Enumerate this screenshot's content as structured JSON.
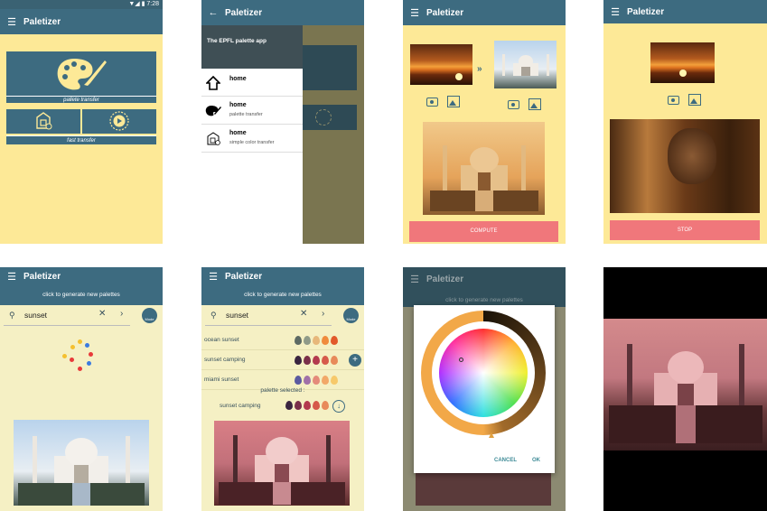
{
  "app": {
    "title": "Paletizer"
  },
  "status": {
    "time": "7:28",
    "icons": "▼◢ ▮"
  },
  "screen1": {
    "palette_transfer_label": "pallete transfer",
    "fast_transfer_label": "fast transfer"
  },
  "screen2": {
    "drawer_header": "The EPFL palette app",
    "items": [
      {
        "title": "home",
        "subtitle": ""
      },
      {
        "title": "home",
        "subtitle": "palette transfer"
      },
      {
        "title": "home",
        "subtitle": "simple color transfer"
      }
    ]
  },
  "screen3": {
    "compute_label": "COMPUTE"
  },
  "screen4": {
    "stop_label": "STOP"
  },
  "screen5": {
    "banner": "click to generate new palettes",
    "search_value": "sunset",
    "badge": "Mode"
  },
  "screen6": {
    "banner": "click to generate new palettes",
    "search_value": "sunset",
    "badge": "Mode",
    "palettes": [
      {
        "name": "ocean sunset",
        "colors": [
          "#5d6a64",
          "#8f9a88",
          "#e7b77a",
          "#f08b3c",
          "#e2592a"
        ]
      },
      {
        "name": "sunset camping",
        "colors": [
          "#3a2540",
          "#7a2f4a",
          "#b33a4e",
          "#d65a4a",
          "#e88a5a"
        ]
      },
      {
        "name": "miami sunset",
        "colors": [
          "#5b5aa0",
          "#a070a8",
          "#e48a7a",
          "#f2a868",
          "#f7c96a"
        ]
      }
    ],
    "selected_label": "palette selected :",
    "selected_name": "sunset camping",
    "selected_colors": [
      "#3a2540",
      "#7a2f4a",
      "#b33a4e",
      "#d65a4a",
      "#e88a5a"
    ]
  },
  "screen7": {
    "banner": "click to generate new palettes",
    "cancel_label": "CANCEL",
    "ok_label": "OK"
  },
  "colors": {
    "teal": "#3d6b80",
    "yellow": "#fde997",
    "cream": "#f5f0c4",
    "pink_button": "#f0777b",
    "orange_ring": "#f2a848"
  }
}
